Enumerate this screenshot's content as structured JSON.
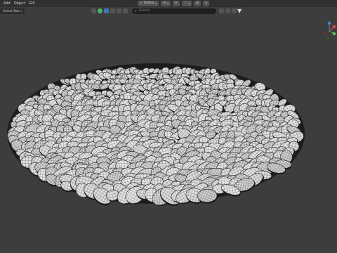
{
  "menu": {
    "items": [
      "Add",
      "Object",
      "GIS"
    ]
  },
  "header": {
    "transform_orientation": "Global",
    "select_mode": "Select Box"
  },
  "outliner": {
    "search_placeholder": "Search"
  },
  "colors": {
    "viewport_bg": "#3d3d3d",
    "header_bg": "#303030",
    "rock_fill": "#d9d9d9",
    "rock_wire": "#2a2a2a",
    "gizmo_x": "#e04a4a",
    "gizmo_y": "#6bc04b",
    "gizmo_z": "#4d7fe0"
  },
  "icons": {
    "search": "search-icon",
    "filter": "funnel-icon",
    "gizmo": "navigation-gizmo-icon"
  }
}
